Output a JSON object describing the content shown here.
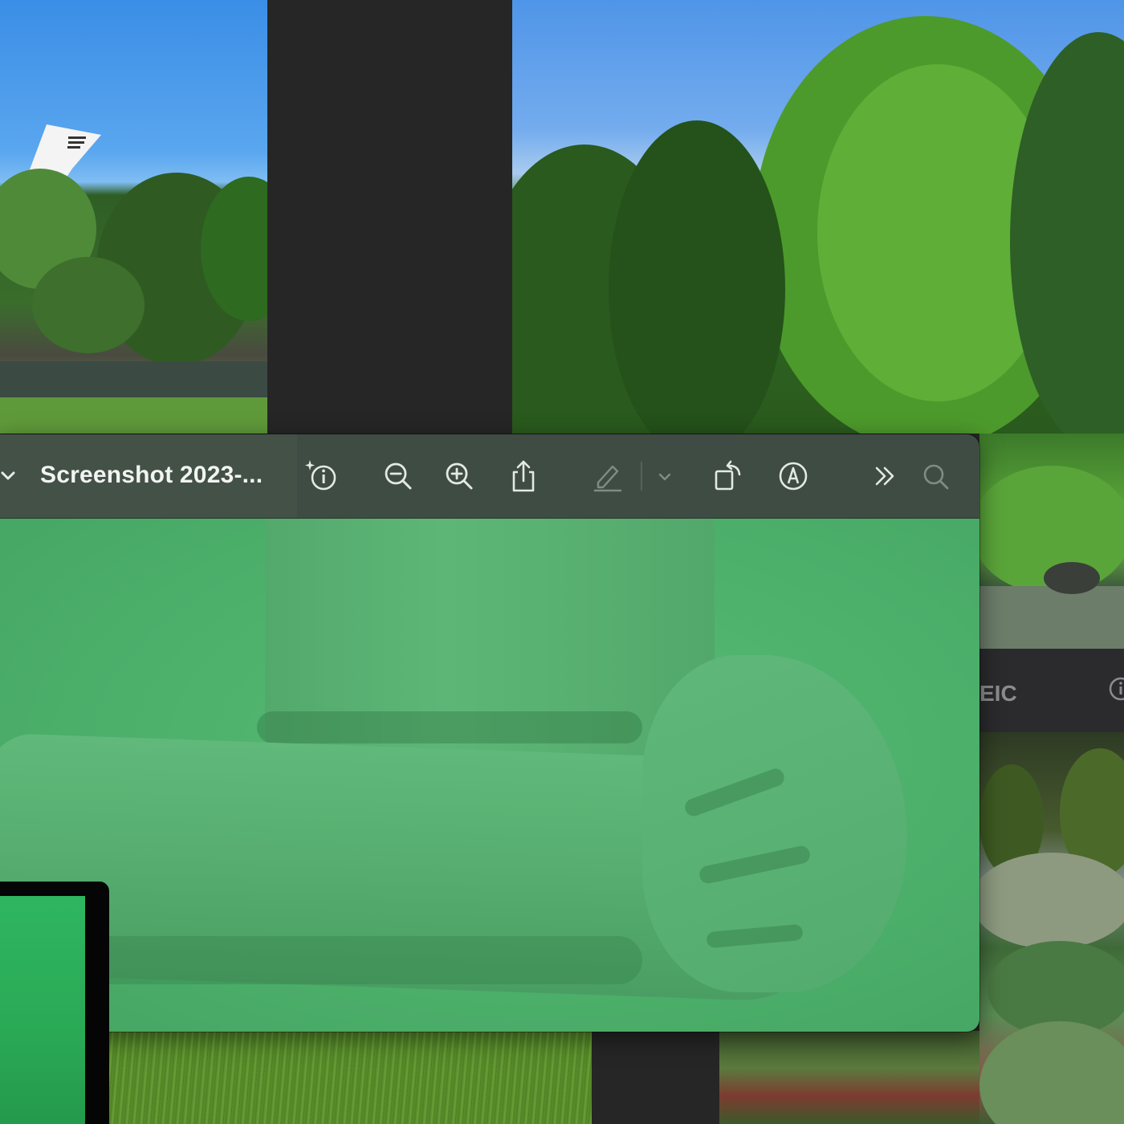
{
  "window": {
    "title": "Screenshot 2023-..."
  },
  "toolbar": {
    "sidebar_toggle_icon": "chevron-down-icon",
    "items": [
      {
        "name": "info-icon",
        "label": "Get Info"
      },
      {
        "name": "zoom-out-icon",
        "label": "Zoom Out"
      },
      {
        "name": "zoom-in-icon",
        "label": "Zoom In"
      },
      {
        "name": "share-icon",
        "label": "Share"
      },
      {
        "name": "markup-pen-icon",
        "label": "Highlight"
      },
      {
        "name": "chevron-down-icon",
        "label": "Highlight Options"
      },
      {
        "name": "rotate-icon",
        "label": "Rotate"
      },
      {
        "name": "markup-icon",
        "label": "Markup"
      },
      {
        "name": "more-icon",
        "label": "More"
      },
      {
        "name": "search-icon",
        "label": "Search"
      }
    ]
  },
  "background_window": {
    "title_fragment": "EIC",
    "info_icon": "info-icon"
  },
  "colors": {
    "toolbar_bg": "#3f4c43",
    "desktop_bg": "#262626",
    "green_screen": "#4fb36d"
  }
}
